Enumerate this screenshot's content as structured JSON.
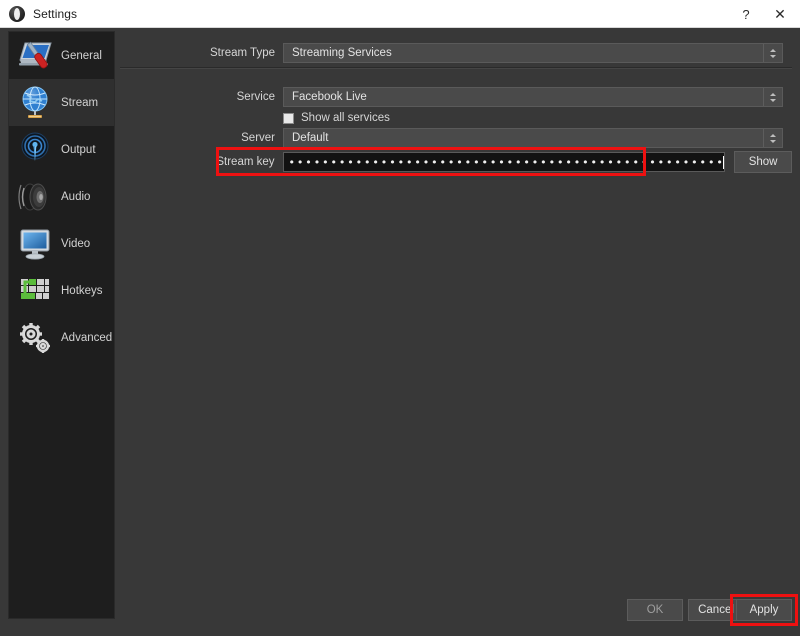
{
  "window": {
    "title": "Settings",
    "app_icon": "obs-icon",
    "help_button": "?",
    "close_button": "✕"
  },
  "sidebar": {
    "items": [
      {
        "label": "General",
        "icon": "general-icon",
        "selected": false
      },
      {
        "label": "Stream",
        "icon": "stream-icon",
        "selected": true
      },
      {
        "label": "Output",
        "icon": "output-icon",
        "selected": false
      },
      {
        "label": "Audio",
        "icon": "audio-icon",
        "selected": false
      },
      {
        "label": "Video",
        "icon": "video-icon",
        "selected": false
      },
      {
        "label": "Hotkeys",
        "icon": "hotkeys-icon",
        "selected": false
      },
      {
        "label": "Advanced",
        "icon": "advanced-icon",
        "selected": false
      }
    ]
  },
  "stream_settings": {
    "stream_type_label": "Stream Type",
    "stream_type_value": "Streaming Services",
    "service_label": "Service",
    "service_value": "Facebook Live",
    "show_all_services_label": "Show all services",
    "show_all_services_checked": false,
    "server_label": "Server",
    "server_value": "Default",
    "stream_key_label": "Stream key",
    "stream_key_value": "••••••••••••••••••••••••••••••••••••••••••••••••••••••••••••••••••",
    "show_key_button": "Show"
  },
  "footer": {
    "ok_label": "OK",
    "cancel_label": "Cancel",
    "apply_label": "Apply"
  },
  "highlights": {
    "accent_color": "#ee1111",
    "stream_key_highlighted": true,
    "apply_highlighted": true
  }
}
